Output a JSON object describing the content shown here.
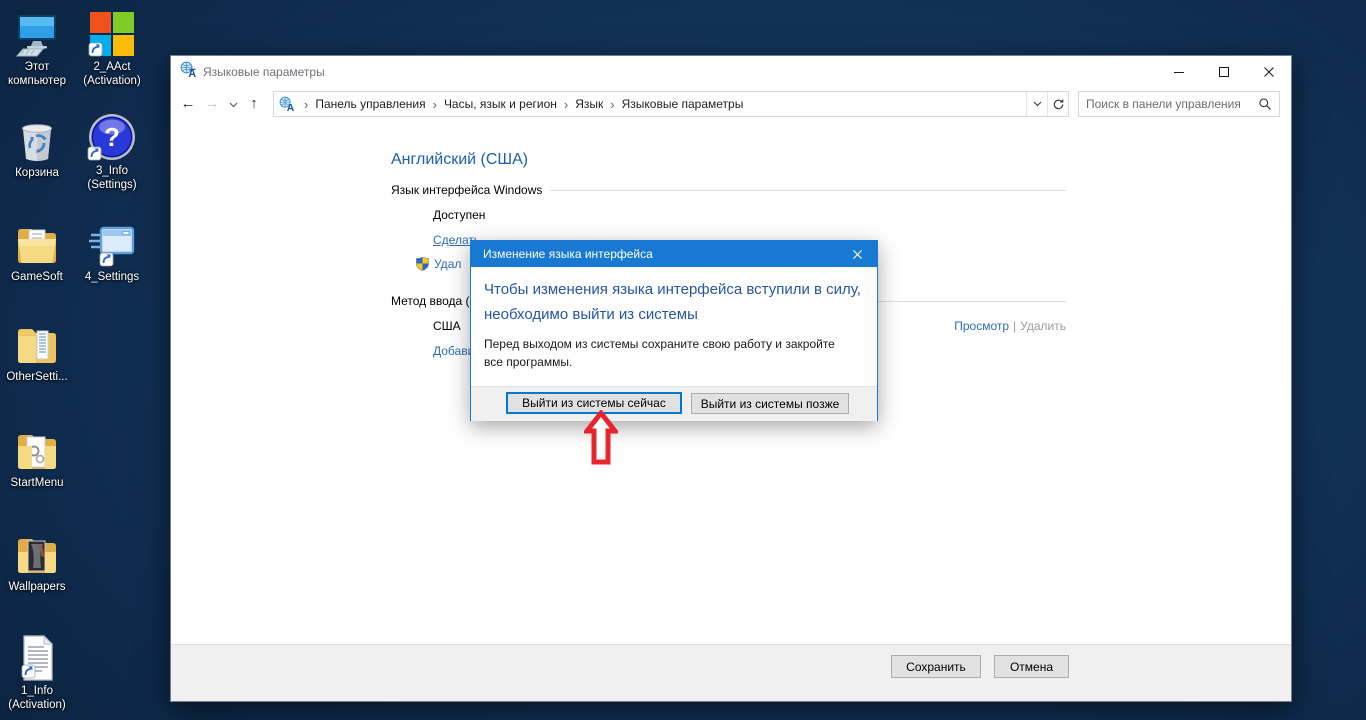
{
  "desktop": {
    "icons": [
      {
        "label": "Этот компьютер",
        "icon": "computer-icon"
      },
      {
        "label": "2_AAct (Activation)",
        "icon": "windows-logo-icon"
      },
      {
        "label": "Корзина",
        "icon": "recycle-bin-icon"
      },
      {
        "label": "3_Info (Settings)",
        "icon": "question-badge-icon"
      },
      {
        "label": "GameSoft",
        "icon": "folder-icon"
      },
      {
        "label": "4_Settings",
        "icon": "app-window-icon"
      },
      {
        "label": "OtherSetti...",
        "icon": "folder-document-icon"
      },
      {
        "label": "StartMenu",
        "icon": "folder-gear-icon"
      },
      {
        "label": "Wallpapers",
        "icon": "folder-image-icon"
      },
      {
        "label": "1_Info (Activation)",
        "icon": "text-document-icon"
      }
    ]
  },
  "window": {
    "title": "Языковые параметры",
    "nav": {
      "back_glyph": "←",
      "forward_glyph": "→",
      "up_glyph": "↑",
      "separator": "›"
    },
    "breadcrumb": [
      "Панель управления",
      "Часы, язык и регион",
      "Язык",
      "Языковые параметры"
    ],
    "search": {
      "placeholder": "Поиск в панели управления"
    },
    "content": {
      "heading": "Английский (США)",
      "section1_label": "Язык интерфейса Windows",
      "available_status": "Доступен",
      "make_primary_link": "Сделать",
      "remove_link": "Удал",
      "section2_label": "Метод ввода (р",
      "input_method_value": "США",
      "add_link": "Добави",
      "preview_link": "Просмотр",
      "links_separator": "|",
      "delete_link": "Удалить"
    },
    "footer": {
      "save_label": "Сохранить",
      "cancel_label": "Отмена"
    }
  },
  "dialog": {
    "title": "Изменение языка интерфейса",
    "heading": "Чтобы изменения языка интерфейса вступили в силу, необходимо выйти из системы",
    "body": "Перед выходом из системы сохраните свою работу и закройте все программы.",
    "logoff_now_label": "Выйти из системы сейчас",
    "logoff_later_label": "Выйти из системы позже"
  },
  "colors": {
    "dialog_accent": "#1779d2",
    "focus_border": "#0078d7",
    "link_blue": "#2a6db8",
    "page_heading_blue": "#1d5fb0",
    "dialog_heading_blue": "#2456a4",
    "annotation_red": "#e8252c"
  }
}
